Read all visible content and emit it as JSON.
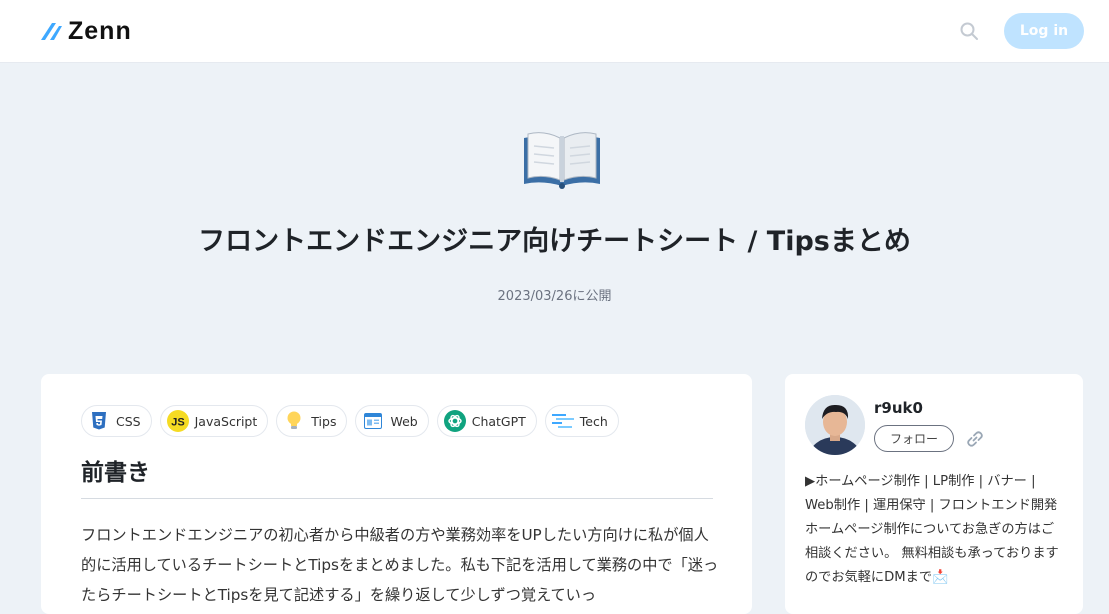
{
  "header": {
    "logo_text": "Zenn",
    "search_icon": "search-icon",
    "login_label": "Log in",
    "accent_color": "#3ea8ff"
  },
  "article": {
    "emoji": "open-book",
    "title": "フロントエンドエンジニア向けチートシート / Tipsまとめ",
    "published": "2023/03/26に公開",
    "topics": [
      {
        "label": "CSS",
        "icon": "css3-icon"
      },
      {
        "label": "JavaScript",
        "icon": "javascript-icon"
      },
      {
        "label": "Tips",
        "icon": "lightbulb-icon"
      },
      {
        "label": "Web",
        "icon": "browser-window-icon"
      },
      {
        "label": "ChatGPT",
        "icon": "openai-icon"
      },
      {
        "label": "Tech",
        "icon": "tech-lines-icon"
      }
    ],
    "section_heading": "前書き",
    "intro": "フロントエンドエンジニアの初心者から中級者の方や業務効率をUPしたい方向けに私が個人的に活用しているチートシートとTipsをまとめました。私も下記を活用して業務の中で「迷ったらチートシートとTipsを見て記述する」を繰り返して少しずつ覚えていっ"
  },
  "author": {
    "name": "r9uk0",
    "follow_label": "フォロー",
    "bio": "▶ホームページ制作 | LP制作 | バナー | Web制作 | 運用保守 | フロントエンド開発 ホームページ制作についてお急ぎの方はご相談ください。 無料相談も承っておりますのでお気軽にDMまで📩"
  }
}
